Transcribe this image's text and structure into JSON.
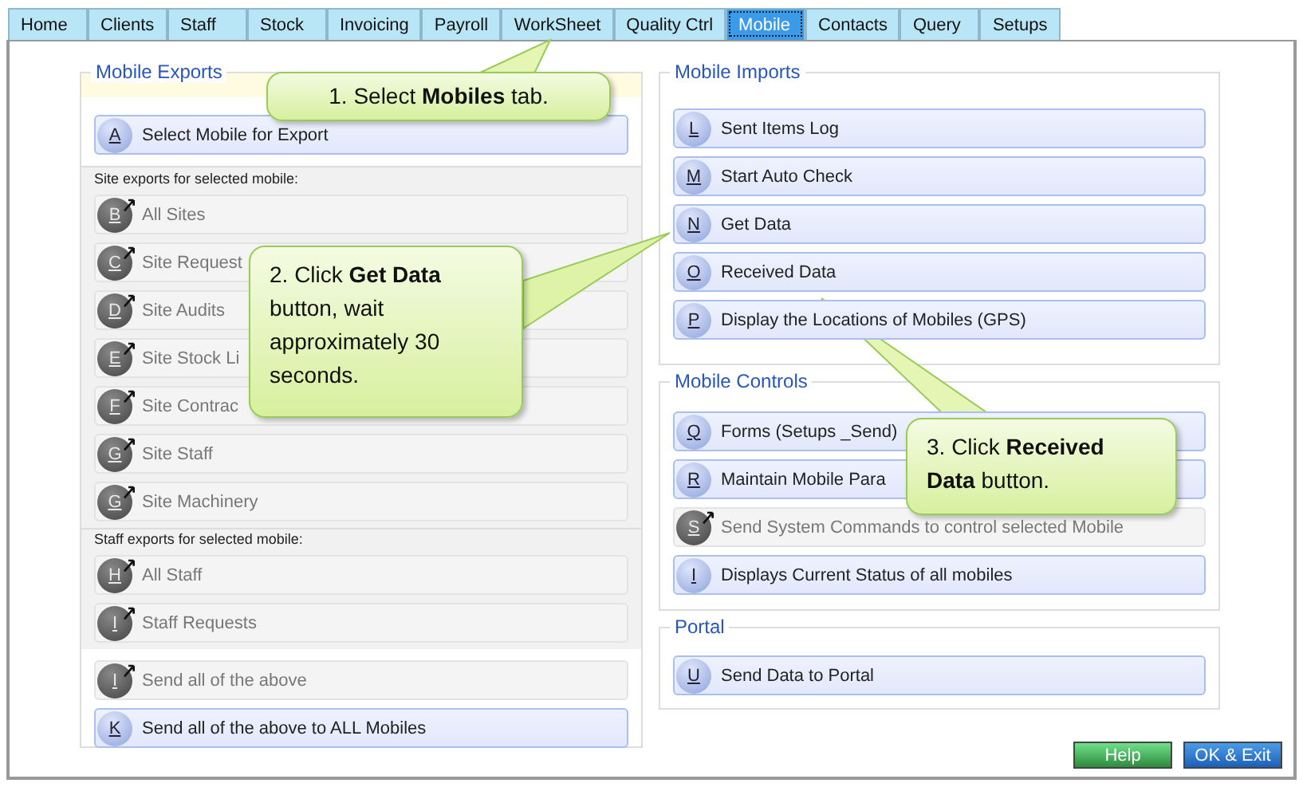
{
  "tabs": [
    {
      "label": "Home",
      "selected": false
    },
    {
      "label": "Clients",
      "selected": false
    },
    {
      "label": "Staff",
      "selected": false
    },
    {
      "label": "Stock",
      "selected": false
    },
    {
      "label": "Invoicing",
      "selected": false
    },
    {
      "label": "Payroll",
      "selected": false
    },
    {
      "label": "WorkSheet",
      "selected": false
    },
    {
      "label": "Quality Ctrl",
      "selected": false
    },
    {
      "label": "Mobile",
      "selected": true
    },
    {
      "label": "Contacts",
      "selected": false
    },
    {
      "label": "Query",
      "selected": false
    },
    {
      "label": "Setups",
      "selected": false
    }
  ],
  "mobile_exports": {
    "title": "Mobile Exports",
    "items": [
      {
        "key": "A",
        "label": "Select Mobile for Export",
        "disabled": false
      }
    ],
    "site_exports": {
      "heading": "Site exports for selected mobile:",
      "items": [
        {
          "key": "B",
          "label": "All Sites",
          "disabled": true
        },
        {
          "key": "C",
          "label": "Site Request",
          "disabled": true
        },
        {
          "key": "D",
          "label": "Site Audits",
          "disabled": true
        },
        {
          "key": "E",
          "label": "Site Stock Li",
          "disabled": true
        },
        {
          "key": "F",
          "label": "Site Contrac",
          "disabled": true
        },
        {
          "key": "G",
          "label": "Site Staff",
          "disabled": true
        },
        {
          "key": "G",
          "label": "Site Machinery",
          "disabled": true
        }
      ]
    },
    "staff_exports": {
      "heading": "Staff exports for selected mobile:",
      "items": [
        {
          "key": "H",
          "label": "All Staff",
          "disabled": true
        },
        {
          "key": "I",
          "label": "Staff Requests",
          "disabled": true
        }
      ]
    },
    "send_items": [
      {
        "key": "I",
        "label": "Send all of the above",
        "disabled": true
      },
      {
        "key": "K",
        "label": "Send all of the above to ALL Mobiles",
        "disabled": false
      }
    ]
  },
  "mobile_imports": {
    "title": "Mobile Imports",
    "items": [
      {
        "key": "L",
        "label": "Sent Items Log",
        "disabled": false
      },
      {
        "key": "M",
        "label": "Start Auto Check",
        "disabled": false
      },
      {
        "key": "N",
        "label": "Get Data",
        "disabled": false
      },
      {
        "key": "O",
        "label": "Received Data",
        "disabled": false
      },
      {
        "key": "P",
        "label": "Display the Locations of Mobiles (GPS)",
        "disabled": false
      }
    ]
  },
  "mobile_controls": {
    "title": "Mobile Controls",
    "items": [
      {
        "key": "Q",
        "label": "Forms (Setups _Send)",
        "disabled": false
      },
      {
        "key": "R",
        "label": "Maintain Mobile Para",
        "disabled": false
      },
      {
        "key": "S",
        "label": "Send System Commands to control selected Mobile",
        "disabled": true
      },
      {
        "key": "I",
        "label": "Displays Current Status of all mobiles",
        "disabled": false
      }
    ]
  },
  "portal": {
    "title": "Portal",
    "items": [
      {
        "key": "U",
        "label": "Send Data to Portal",
        "disabled": false
      }
    ]
  },
  "buttons": [
    {
      "label": "Help",
      "kind": "help"
    },
    {
      "label": "OK & Exit",
      "kind": "ok"
    }
  ],
  "callouts": [
    {
      "text": "1. Select **Mobiles** tab."
    },
    {
      "text": "2. Click **Get Data** button, wait approximately 30 seconds."
    },
    {
      "text": "3. Click **Received Data** button."
    }
  ]
}
